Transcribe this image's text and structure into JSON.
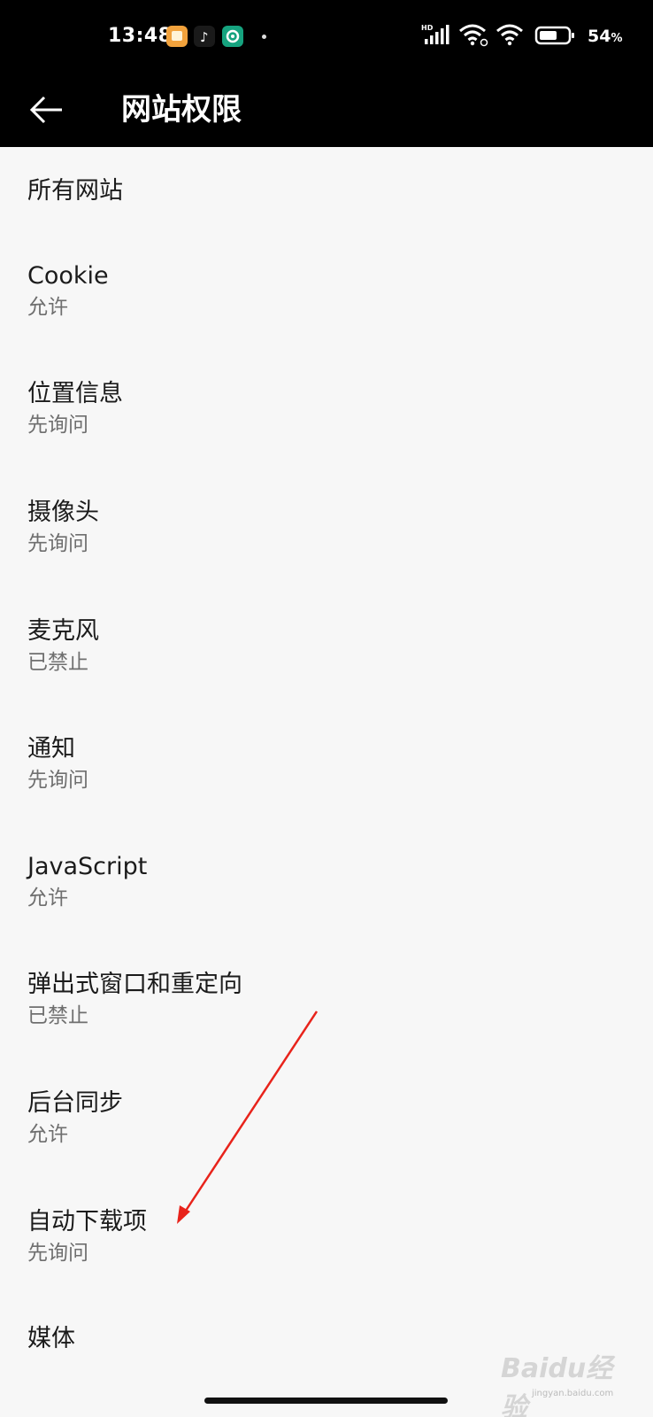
{
  "status_bar": {
    "time": "13:48",
    "battery": "54",
    "battery_unit": "%",
    "network_badge": "HD"
  },
  "app_bar": {
    "title": "网站权限"
  },
  "settings": [
    {
      "label": "所有网站",
      "value": ""
    },
    {
      "label": "Cookie",
      "value": "允许"
    },
    {
      "label": "位置信息",
      "value": "先询问"
    },
    {
      "label": "摄像头",
      "value": "先询问"
    },
    {
      "label": "麦克风",
      "value": "已禁止"
    },
    {
      "label": "通知",
      "value": "先询问"
    },
    {
      "label": "JavaScript",
      "value": "允许"
    },
    {
      "label": "弹出式窗口和重定向",
      "value": "已禁止"
    },
    {
      "label": "后台同步",
      "value": "允许"
    },
    {
      "label": "自动下载项",
      "value": "先询问"
    },
    {
      "label": "媒体",
      "value": ""
    }
  ],
  "annotation": {
    "arrow_color": "#e8231b"
  },
  "watermark": {
    "brand": "Baidu经验",
    "url": "jingyan.baidu.com"
  }
}
